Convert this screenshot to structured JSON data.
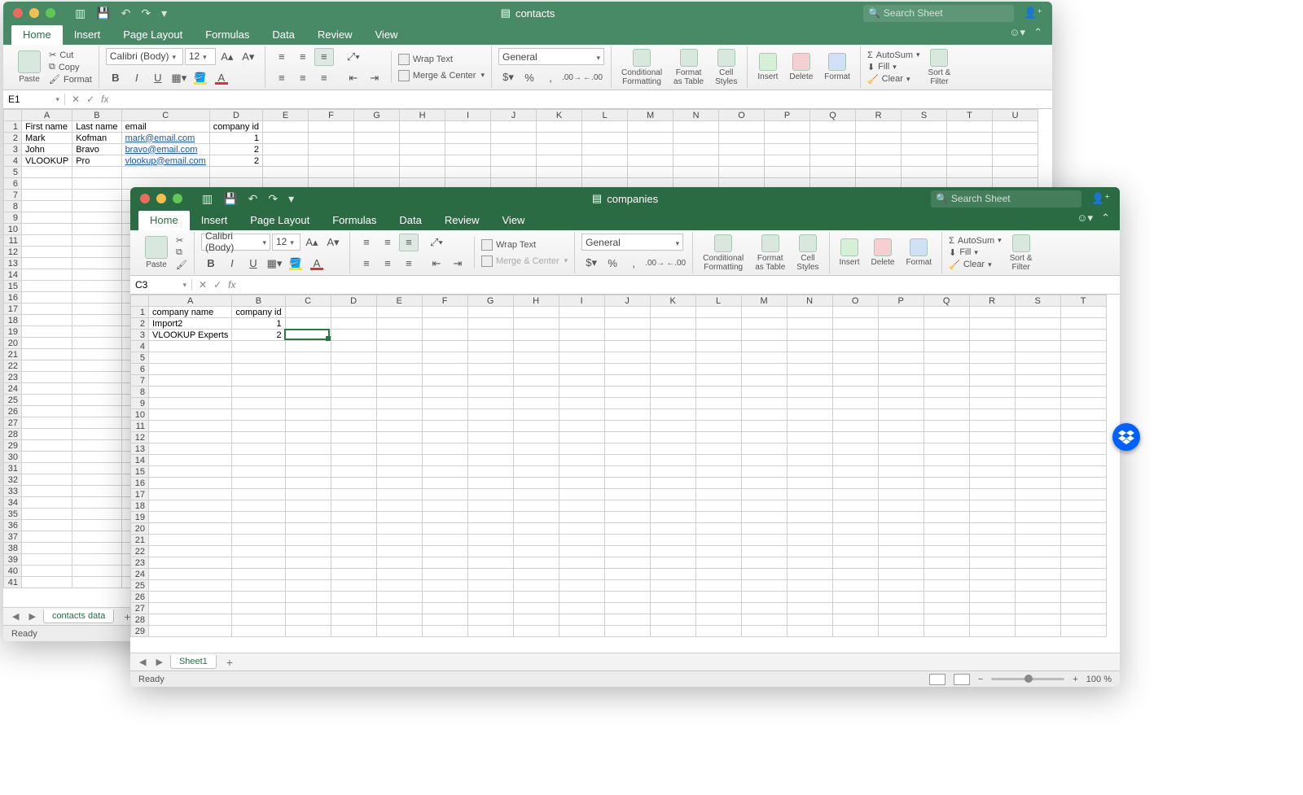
{
  "back_window": {
    "title": "contacts",
    "search_placeholder": "Search Sheet",
    "ribbon_tabs": [
      "Home",
      "Insert",
      "Page Layout",
      "Formulas",
      "Data",
      "Review",
      "View"
    ],
    "font_name": "Calibri (Body)",
    "font_size": "12",
    "number_format": "General",
    "labels": {
      "paste": "Paste",
      "cut": "Cut",
      "copy": "Copy",
      "format_painter": "Format",
      "wrap_text": "Wrap Text",
      "merge_center": "Merge & Center",
      "conditional_formatting": "Conditional\nFormatting",
      "format_as_table": "Format\nas Table",
      "cell_styles": "Cell\nStyles",
      "insert": "Insert",
      "delete": "Delete",
      "format": "Format",
      "autosum": "AutoSum",
      "fill": "Fill",
      "clear": "Clear",
      "sort_filter": "Sort &\nFilter"
    },
    "name_box": "E1",
    "columns": [
      "A",
      "B",
      "C",
      "D",
      "E",
      "F",
      "G",
      "H",
      "I",
      "J",
      "K",
      "L",
      "M",
      "N",
      "O",
      "P",
      "Q",
      "R",
      "S",
      "T",
      "U"
    ],
    "row_count": 41,
    "data": {
      "headers": [
        "First name",
        "Last name",
        "email",
        "company id"
      ],
      "rows": [
        [
          "Mark",
          "Kofman",
          "mark@email.com",
          "1"
        ],
        [
          "John",
          "Bravo",
          "bravo@email.com",
          "2"
        ],
        [
          "VLOOKUP",
          "Pro",
          "vlookup@email.com",
          "2"
        ]
      ]
    },
    "sheet_tab": "contacts data",
    "status": "Ready"
  },
  "front_window": {
    "title": "companies",
    "search_placeholder": "Search Sheet",
    "ribbon_tabs": [
      "Home",
      "Insert",
      "Page Layout",
      "Formulas",
      "Data",
      "Review",
      "View"
    ],
    "font_name": "Calibri (Body)",
    "font_size": "12",
    "number_format": "General",
    "labels": {
      "paste": "Paste",
      "cut": "Cut",
      "copy": "Copy",
      "format_painter": "Format",
      "wrap_text": "Wrap Text",
      "merge_center": "Merge & Center",
      "conditional_formatting": "Conditional\nFormatting",
      "format_as_table": "Format\nas Table",
      "cell_styles": "Cell\nStyles",
      "insert": "Insert",
      "delete": "Delete",
      "format": "Format",
      "autosum": "AutoSum",
      "fill": "Fill",
      "clear": "Clear",
      "sort_filter": "Sort &\nFilter"
    },
    "name_box": "C3",
    "columns": [
      "A",
      "B",
      "C",
      "D",
      "E",
      "F",
      "G",
      "H",
      "I",
      "J",
      "K",
      "L",
      "M",
      "N",
      "O",
      "P",
      "Q",
      "R",
      "S",
      "T"
    ],
    "row_count": 29,
    "data": {
      "headers": [
        "company name",
        "company id"
      ],
      "rows": [
        [
          "Import2",
          "1"
        ],
        [
          "VLOOKUP Experts",
          "2"
        ]
      ]
    },
    "selected_cell": "C3",
    "sheet_tab": "Sheet1",
    "status": "Ready",
    "zoom": "100 %"
  }
}
